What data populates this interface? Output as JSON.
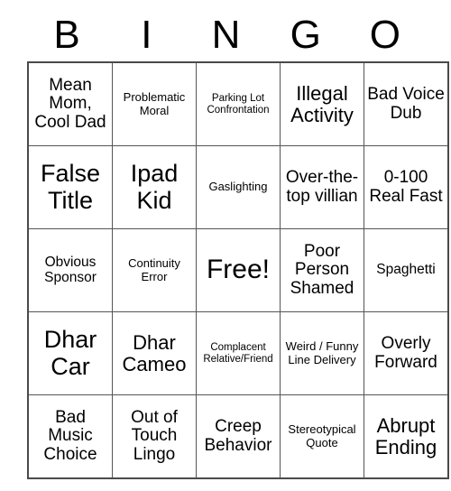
{
  "card": {
    "header_letters": [
      "B",
      "I",
      "N",
      "G",
      "O"
    ],
    "free_space_label": "Free!",
    "rows": [
      [
        {
          "text": "Mean Mom, Cool Dad",
          "size": "lg"
        },
        {
          "text": "Problematic Moral",
          "size": "sm"
        },
        {
          "text": "Parking Lot Confrontation",
          "size": "xs"
        },
        {
          "text": "Illegal Activity",
          "size": "xl"
        },
        {
          "text": "Bad Voice Dub",
          "size": "lg"
        }
      ],
      [
        {
          "text": "False Title",
          "size": "xxl"
        },
        {
          "text": "Ipad Kid",
          "size": "xxl"
        },
        {
          "text": "Gaslighting",
          "size": "sm"
        },
        {
          "text": "Over-the-top villian",
          "size": "lg"
        },
        {
          "text": "0-100 Real Fast",
          "size": "lg"
        }
      ],
      [
        {
          "text": "Obvious Sponsor",
          "size": "md"
        },
        {
          "text": "Continuity Error",
          "size": "sm"
        },
        {
          "text": "Free!",
          "size": "free"
        },
        {
          "text": "Poor Person Shamed",
          "size": "lg"
        },
        {
          "text": "Spaghetti",
          "size": "md"
        }
      ],
      [
        {
          "text": "Dhar Car",
          "size": "xxl"
        },
        {
          "text": "Dhar Cameo",
          "size": "xl"
        },
        {
          "text": "Complacent Relative/Friend",
          "size": "xs"
        },
        {
          "text": "Weird / Funny Line Delivery",
          "size": "sm"
        },
        {
          "text": "Overly Forward",
          "size": "lg"
        }
      ],
      [
        {
          "text": "Bad Music Choice",
          "size": "lg"
        },
        {
          "text": "Out of Touch Lingo",
          "size": "lg"
        },
        {
          "text": "Creep Behavior",
          "size": "lg"
        },
        {
          "text": "Stereotypical Quote",
          "size": "sm"
        },
        {
          "text": "Abrupt Ending",
          "size": "xl"
        }
      ]
    ]
  },
  "colors": {
    "background": "#ffffff",
    "text": "#000000",
    "grid_line": "#555555",
    "grid_outer": "#4a4a4a"
  }
}
